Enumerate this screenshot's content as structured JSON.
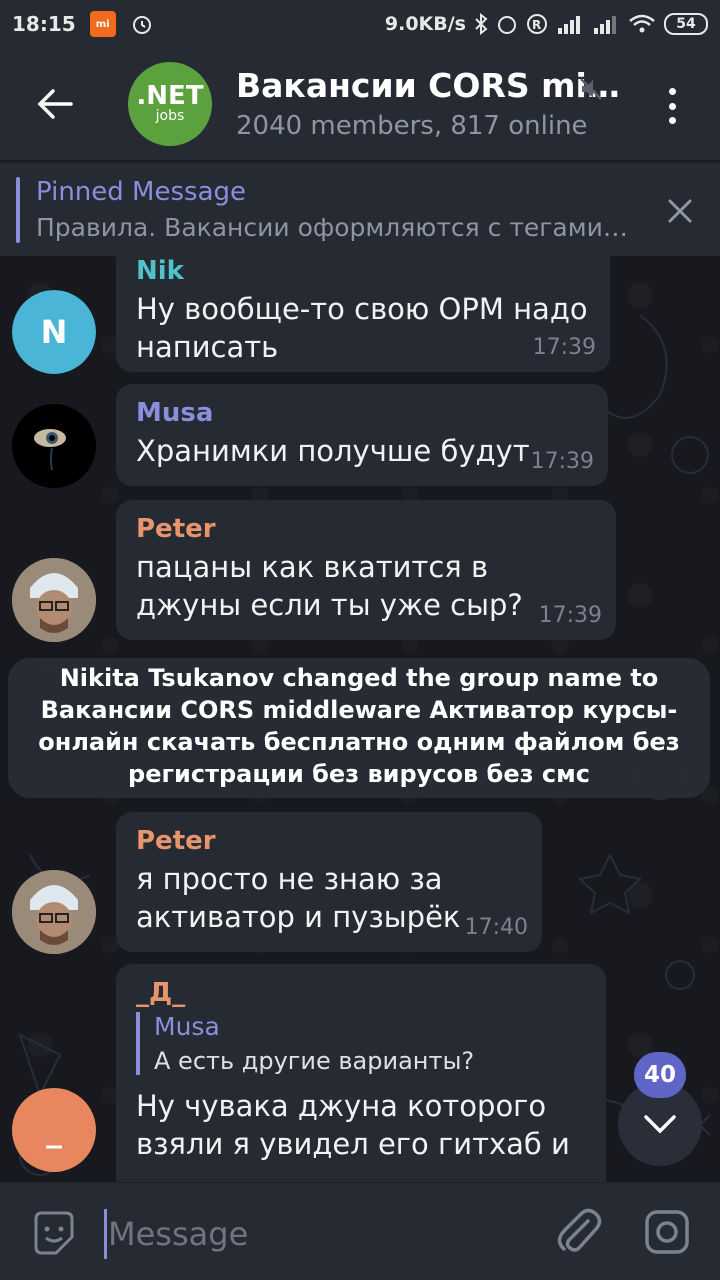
{
  "status_bar": {
    "time": "18:15",
    "net_speed": "9.0KB/s",
    "battery": "54"
  },
  "header": {
    "title": "Вакансии CORS mi…",
    "subtitle": "2040 members, 817 online",
    "avatar_line1": ".NET",
    "avatar_line2": "jobs"
  },
  "pinned": {
    "title": "Pinned Message",
    "text": "Правила.  Вакансии оформляются с тегами…"
  },
  "messages": [
    {
      "sender": "Nik",
      "sender_color": "#4fc3c9",
      "avatar_letter": "N",
      "avatar_color": "#4ab5d6",
      "text": "Ну вообще-то свою ОРМ надо написать",
      "time": "17:39"
    },
    {
      "sender": "Musa",
      "sender_color": "#8a8fdc",
      "text": "Хранимки получше будут",
      "time": "17:39"
    },
    {
      "sender": "Peter",
      "sender_color": "#e8956b",
      "text": "пацаны как вкатится в джуны если ты уже сыр?",
      "time": "17:39"
    },
    {
      "sender": "Peter",
      "sender_color": "#e8956b",
      "text": "я просто не знаю за активатор и пузырёк",
      "time": "17:40"
    },
    {
      "sender": "_Д_",
      "sender_color": "#e8956b",
      "avatar_letter": "_",
      "avatar_color": "#e8875f",
      "reply_name": "Musa",
      "reply_text": "А есть другие варианты?",
      "text": "Ну чувака джуна которого взяли я увидел его гитхаб и"
    }
  ],
  "service_message": "Nikita Tsukanov changed the group name to Вакансии CORS middleware Активатор курсы-онлайн скачать бесплатно одним файлом без регистрации без вирусов без смс",
  "unread_count": "40",
  "input": {
    "placeholder": "Message"
  }
}
